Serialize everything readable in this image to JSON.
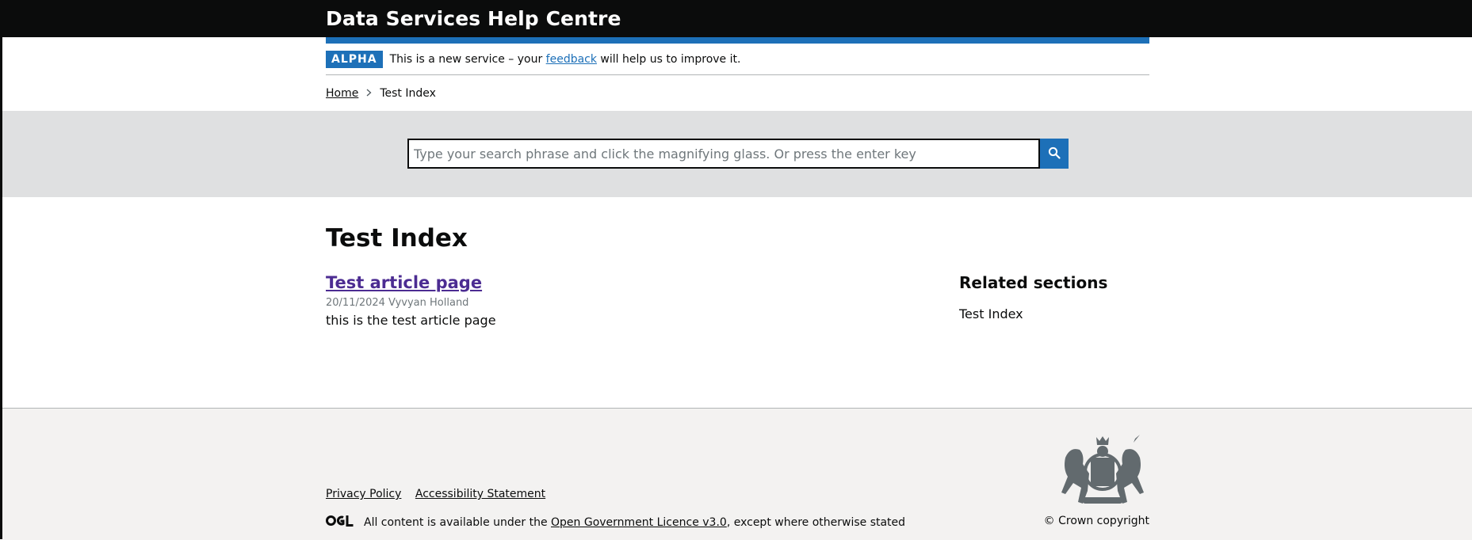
{
  "header": {
    "title": "Data Services Help Centre"
  },
  "phase_banner": {
    "tag": "ALPHA",
    "text_before": "This is a new service – your ",
    "link": "feedback",
    "text_after": " will help us to improve it."
  },
  "breadcrumbs": {
    "home": "Home",
    "current": "Test Index"
  },
  "search": {
    "placeholder": "Type your search phrase and click the magnifying glass. Or press the enter key"
  },
  "main": {
    "title": "Test Index",
    "articles": [
      {
        "title": "Test article page",
        "meta": "20/11/2024 Vyvyan Holland",
        "description": "this is the test article page"
      }
    ],
    "related": {
      "heading": "Related sections",
      "items": [
        "Test Index"
      ]
    }
  },
  "footer": {
    "links": [
      "Privacy Policy",
      "Accessibility Statement"
    ],
    "licence_before": "All content is available under the ",
    "licence_link": "Open Government Licence v3.0",
    "licence_after": ", except where otherwise stated",
    "copyright": "© Crown copyright"
  },
  "colors": {
    "brand_blue": "#1d70b8",
    "header_black": "#0b0c0c",
    "visited_link": "#4c2c92",
    "search_band": "#dfe0e1",
    "footer_bg": "#f3f2f1"
  },
  "icons": {
    "search": "magnifying-glass-icon",
    "breadcrumb_separator": "chevron-right-icon",
    "ogl_logo": "ogl-logo",
    "crest": "royal-coat-of-arms"
  }
}
